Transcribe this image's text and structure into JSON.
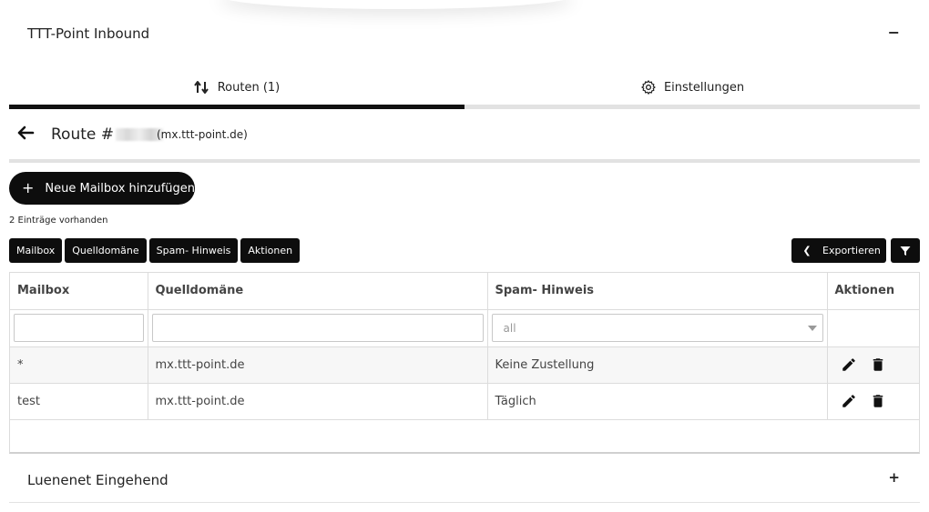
{
  "panel": {
    "title": "TTT-Point Inbound",
    "toggle": "−"
  },
  "tabs": [
    {
      "label": "Routen (1)",
      "icon": "route-icon",
      "active": true
    },
    {
      "label": "Einstellungen",
      "icon": "gear-icon",
      "active": false
    }
  ],
  "route": {
    "title": "Route #",
    "domain": "(mx.ttt-point.de)"
  },
  "add_button": {
    "icon": "plus-icon",
    "label": "Neue Mailbox hinzufügen"
  },
  "count_text": "2 Einträge vorhanden",
  "column_toggles": [
    "Mailbox",
    "Quelldomäne",
    "Spam- Hinweis",
    "Aktionen"
  ],
  "export_button": {
    "label": "Exportieren",
    "icon": "chevron-left-icon"
  },
  "filter_button": {
    "icon": "filter-icon"
  },
  "table": {
    "headers": [
      "Mailbox",
      "Quelldomäne",
      "Spam- Hinweis",
      "Aktionen"
    ],
    "filter_select": "all",
    "rows": [
      {
        "mailbox": "*",
        "domain": "mx.ttt-point.de",
        "spam": "Keine Zustellung"
      },
      {
        "mailbox": "test",
        "domain": "mx.ttt-point.de",
        "spam": "Täglich"
      }
    ]
  },
  "panel2": {
    "title": "Luenenet Eingehend",
    "toggle": "+"
  },
  "colors": {
    "primary": "#0d0d0d",
    "divider": "#e2e2e2"
  }
}
